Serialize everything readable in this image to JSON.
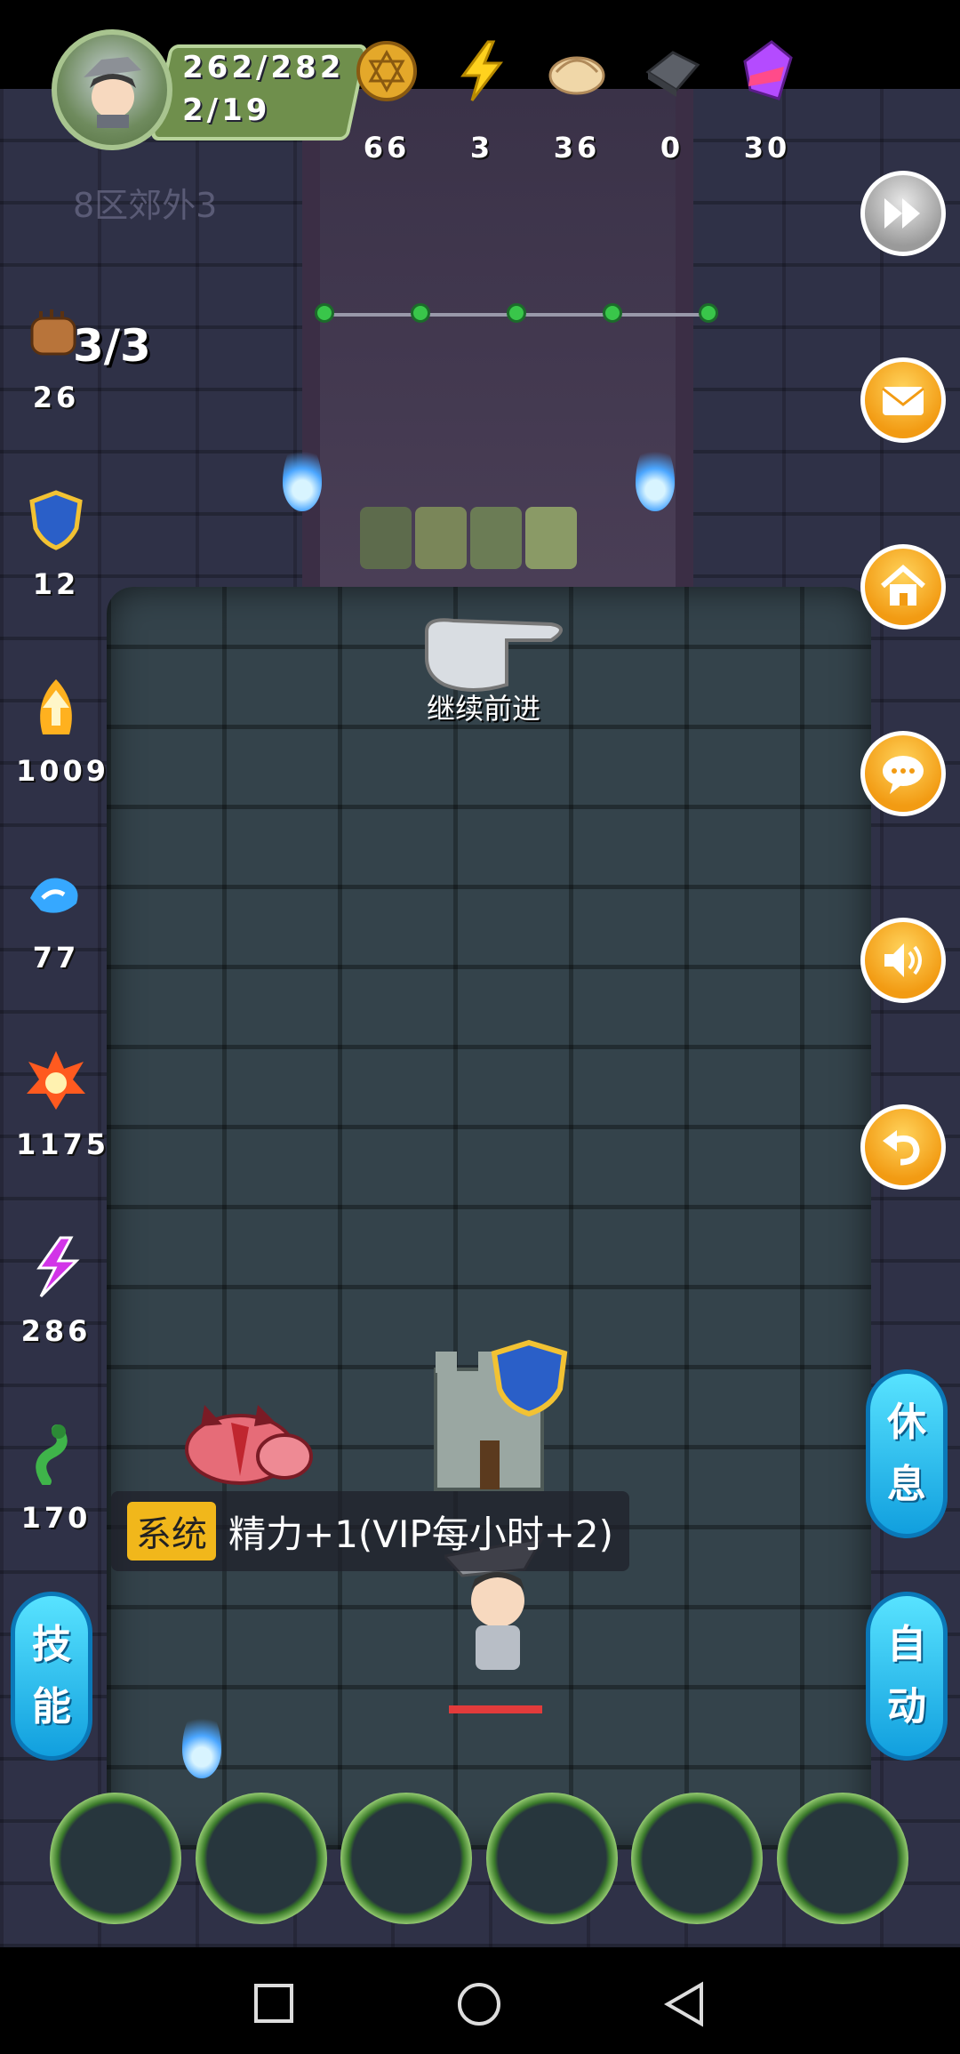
{
  "player": {
    "hp": "262/282",
    "floor": "2/19",
    "location_faded": "8区郊外3"
  },
  "resources": [
    {
      "icon": "gold-coin-icon",
      "value": "66"
    },
    {
      "icon": "lightning-energy-icon",
      "value": "3"
    },
    {
      "icon": "dumpling-food-icon",
      "value": "36"
    },
    {
      "icon": "iron-ore-icon",
      "value": "0"
    },
    {
      "icon": "purple-crystal-icon",
      "value": "30"
    }
  ],
  "action_count": "3/3",
  "stats": [
    {
      "icon": "fist-attack-icon",
      "value": "26"
    },
    {
      "icon": "shield-defense-icon",
      "value": "12"
    },
    {
      "icon": "fire-arrow-icon",
      "value": "1009"
    },
    {
      "icon": "water-wave-icon",
      "value": "77"
    },
    {
      "icon": "fire-burst-icon",
      "value": "1175"
    },
    {
      "icon": "lightning-crack-icon",
      "value": "286"
    },
    {
      "icon": "poison-snake-icon",
      "value": "170"
    }
  ],
  "hint": {
    "text": "继续前进"
  },
  "message": {
    "tag": "系统",
    "text": "精力+1(VIP每小时+2)"
  },
  "buttons": {
    "rest": [
      "休",
      "息"
    ],
    "skill": [
      "技",
      "能"
    ],
    "auto": [
      "自",
      "动"
    ]
  },
  "colors": {
    "accent": "#f29b13",
    "pill": "#1fb8ee",
    "tag": "#f1b71b"
  }
}
